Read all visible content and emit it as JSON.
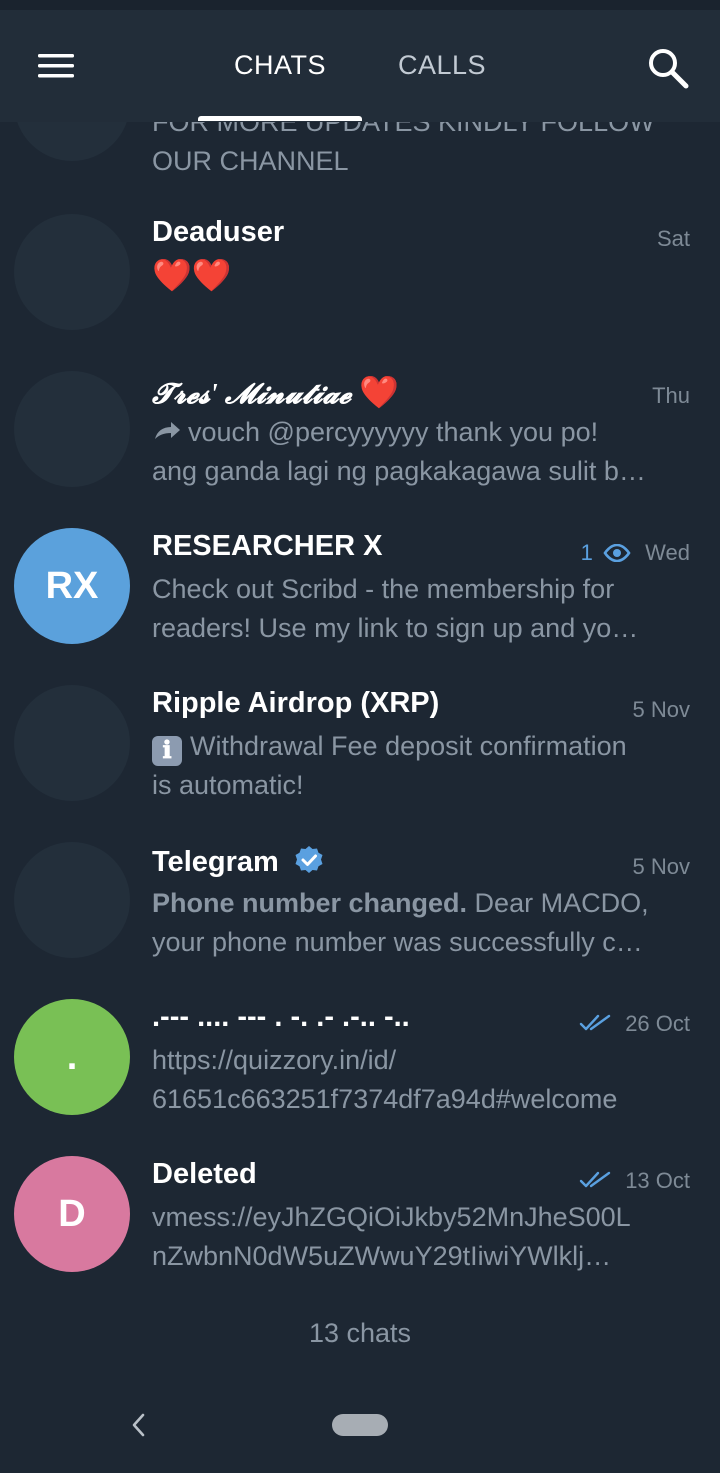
{
  "header": {
    "tabs": [
      {
        "label": "CHATS"
      },
      {
        "label": "CALLS"
      }
    ]
  },
  "colors": {
    "accent": "#5aa0e0",
    "background": "#1d2733",
    "header": "#222d39",
    "avatar_rx": "#5ba1dc",
    "avatar_dot": "#79c055",
    "avatar_d": "#d8799f"
  },
  "chats": [
    {
      "name": "",
      "date": "",
      "message_lines": [
        "FOR MORE UPDATES KINDLY FOLLOW",
        "OUR CHANNEL"
      ]
    },
    {
      "name": "Deaduser",
      "date": "Sat",
      "message": "❤️❤️"
    },
    {
      "name": "𝓣𝓻𝓮𝓼' 𝓜𝓲𝓷𝓾𝓽𝓲𝓪𝓮",
      "name_suffix": "❤️",
      "date": "Thu",
      "message_lines": [
        "vouch @percyyyyyy thank you po!",
        "ang ganda lagi ng pagkakagawa sulit b…"
      ]
    },
    {
      "name": "RESEARCHER X",
      "avatar_initials": "RX",
      "views": "1",
      "date": "Wed",
      "message_lines": [
        "Check out Scribd - the membership for",
        "readers! Use my link to sign up and yo…"
      ]
    },
    {
      "name": "Ripple Airdrop (XRP)",
      "date": "5 Nov",
      "info_icon": "ℹ",
      "message_lines": [
        "Withdrawal Fee deposit confirmation",
        "is automatic!"
      ]
    },
    {
      "name": "Telegram",
      "date": "5 Nov",
      "message_bold": "Phone number changed.",
      "message_lines": [
        " Dear MACDO,",
        "your phone number was successfully c…"
      ]
    },
    {
      "name": ".--- .... --- . -. .- .-.. -..",
      "avatar_initials": ".",
      "date": "26 Oct",
      "message_lines": [
        "https://quizzory.in/id/",
        "61651c663251f7374df7a94d#welcome"
      ]
    },
    {
      "name": "Deleted",
      "avatar_initials": "D",
      "date": "13 Oct",
      "message_lines": [
        "vmess://eyJhZGQiOiJkby52MnJheS00L",
        "nZwbnN0dW5uZWwuY29tIiwiYWlklj…"
      ]
    }
  ],
  "footer": {
    "count": "13 chats"
  },
  "icons": [
    "menu-icon",
    "search-icon",
    "forward-icon",
    "eye-icon",
    "verified-icon",
    "double-check-icon",
    "info-icon",
    "back-icon"
  ]
}
